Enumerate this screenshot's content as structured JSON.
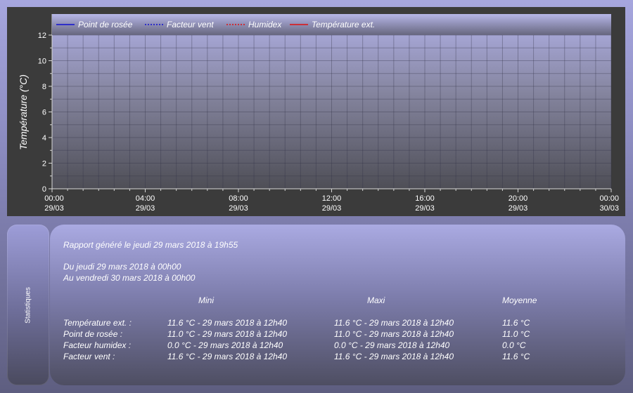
{
  "chart_data": {
    "type": "line",
    "ylabel": "Température (°C)",
    "ylim": [
      0,
      12
    ],
    "yticks": [
      0,
      2,
      4,
      6,
      8,
      10,
      12
    ],
    "xticks": [
      {
        "time": "00:00",
        "date": "29/03"
      },
      {
        "time": "04:00",
        "date": "29/03"
      },
      {
        "time": "08:00",
        "date": "29/03"
      },
      {
        "time": "12:00",
        "date": "29/03"
      },
      {
        "time": "16:00",
        "date": "29/03"
      },
      {
        "time": "20:00",
        "date": "29/03"
      },
      {
        "time": "00:00",
        "date": "30/03"
      }
    ],
    "grid": true,
    "legend_position": "top",
    "series": [
      {
        "name": "Point de rosée",
        "color": "#1010d0",
        "style": "solid",
        "values": []
      },
      {
        "name": "Facteur vent",
        "color": "#1010d0",
        "style": "dotted",
        "values": []
      },
      {
        "name": "Humidex",
        "color": "#e01010",
        "style": "dotted",
        "values": []
      },
      {
        "name": "Température ext.",
        "color": "#e01010",
        "style": "solid",
        "values": []
      }
    ]
  },
  "side_tab": {
    "label": "Statistiques"
  },
  "report": {
    "generated": "Rapport généré le jeudi 29 mars 2018 à 19h55",
    "from": "Du jeudi 29 mars 2018 à 00h00",
    "to": "Au vendredi 30 mars 2018 à 00h00",
    "headers": {
      "mini": "Mini",
      "maxi": "Maxi",
      "moyenne": "Moyenne"
    },
    "rows": [
      {
        "label": "Température ext. :",
        "mini": "11.6 °C - 29 mars 2018 à 12h40",
        "maxi": "11.6 °C - 29 mars 2018 à 12h40",
        "moyenne": "11.6 °C"
      },
      {
        "label": "Point de rosée :",
        "mini": "11.0 °C - 29 mars 2018 à 12h40",
        "maxi": "11.0 °C - 29 mars 2018 à 12h40",
        "moyenne": "11.0 °C"
      },
      {
        "label": "Facteur humidex :",
        "mini": "0.0 °C - 29 mars 2018 à 12h40",
        "maxi": "0.0 °C - 29 mars 2018 à 12h40",
        "moyenne": "0.0 °C"
      },
      {
        "label": "Facteur vent :",
        "mini": "11.6 °C - 29 mars 2018 à 12h40",
        "maxi": "11.6 °C - 29 mars 2018 à 12h40",
        "moyenne": "11.6 °C"
      }
    ]
  }
}
